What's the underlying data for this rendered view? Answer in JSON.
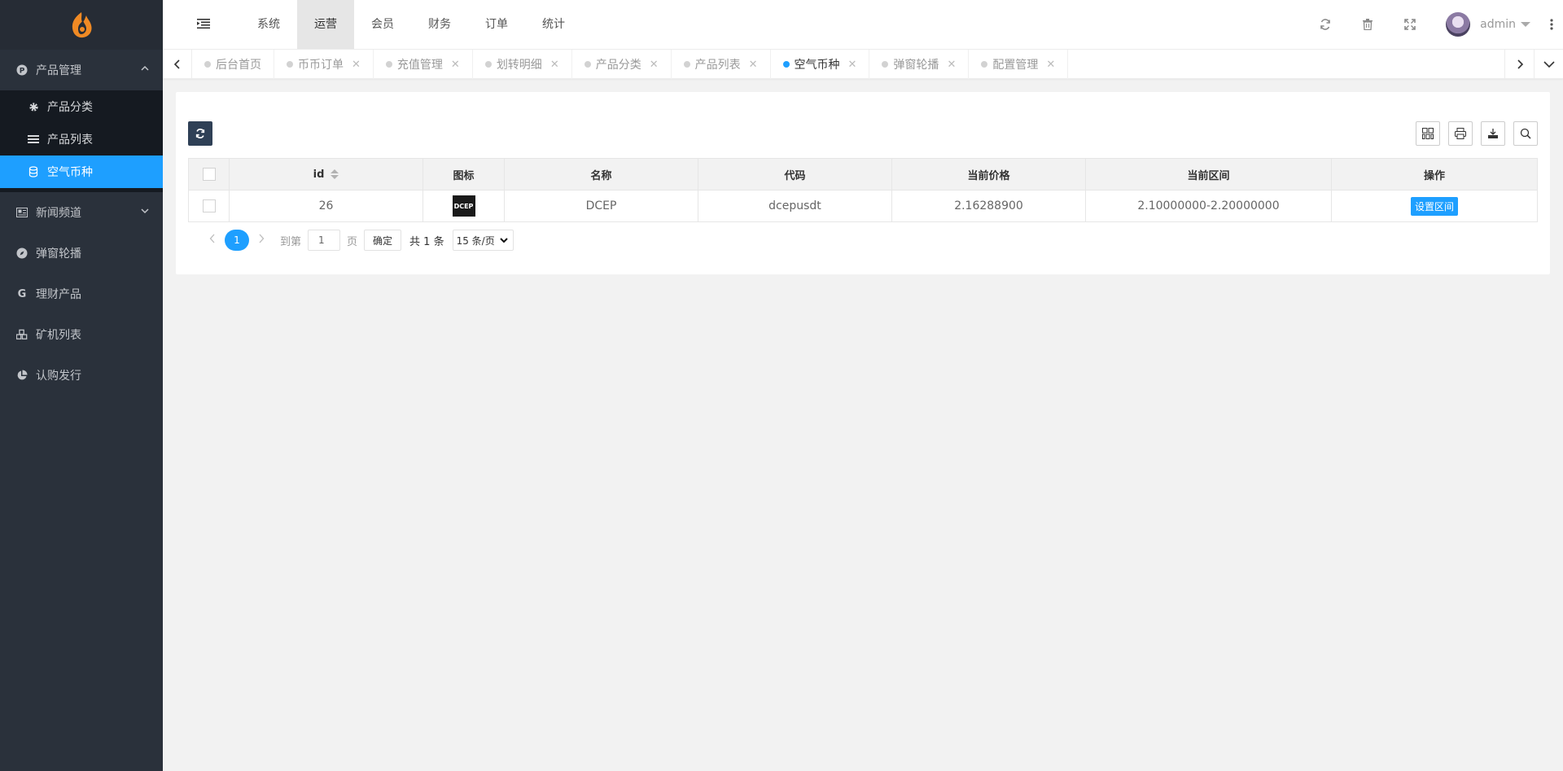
{
  "sidebar": {
    "groups": [
      {
        "label": "产品管理",
        "icon": "p-circle-icon",
        "expanded": true,
        "items": [
          {
            "label": "产品分类",
            "icon": "gear-icon",
            "active": false
          },
          {
            "label": "产品列表",
            "icon": "list-icon",
            "active": false
          },
          {
            "label": "空气币种",
            "icon": "coin-icon",
            "active": true
          }
        ]
      },
      {
        "label": "新闻频道",
        "icon": "newspaper-icon"
      },
      {
        "label": "弹窗轮播",
        "icon": "compass-icon"
      },
      {
        "label": "理财产品",
        "icon": "g-letter-icon"
      },
      {
        "label": "矿机列表",
        "icon": "cubes-icon"
      },
      {
        "label": "认购发行",
        "icon": "pie-chart-icon"
      }
    ]
  },
  "header": {
    "nav": [
      "系统",
      "运营",
      "会员",
      "财务",
      "订单",
      "统计"
    ],
    "active_nav": "运营",
    "username": "admin"
  },
  "tabs": [
    {
      "label": "后台首页",
      "closable": false,
      "active": false
    },
    {
      "label": "币币订单",
      "closable": true,
      "active": false
    },
    {
      "label": "充值管理",
      "closable": true,
      "active": false
    },
    {
      "label": "划转明细",
      "closable": true,
      "active": false
    },
    {
      "label": "产品分类",
      "closable": true,
      "active": false
    },
    {
      "label": "产品列表",
      "closable": true,
      "active": false
    },
    {
      "label": "空气币种",
      "closable": true,
      "active": true
    },
    {
      "label": "弹窗轮播",
      "closable": true,
      "active": false
    },
    {
      "label": "配置管理",
      "closable": true,
      "active": false
    }
  ],
  "table": {
    "columns": [
      "id",
      "图标",
      "名称",
      "代码",
      "当前价格",
      "当前区间",
      "操作"
    ],
    "rows": [
      {
        "id": "26",
        "icon_text": "DCEP",
        "name": "DCEP",
        "code": "dcepusdt",
        "price": "2.16288900",
        "range": "2.10000000-2.20000000",
        "action": "设置区间"
      }
    ]
  },
  "pager": {
    "current": "1",
    "goto_label": "到第",
    "goto_value": "1",
    "page_label": "页",
    "confirm": "确定",
    "total": "共 1 条",
    "per_page": "15 条/页"
  },
  "colors": {
    "accent": "#1e9fff",
    "sidebar": "#2a313b",
    "submenu": "#151a21",
    "refresh_btn": "#2f4056"
  }
}
